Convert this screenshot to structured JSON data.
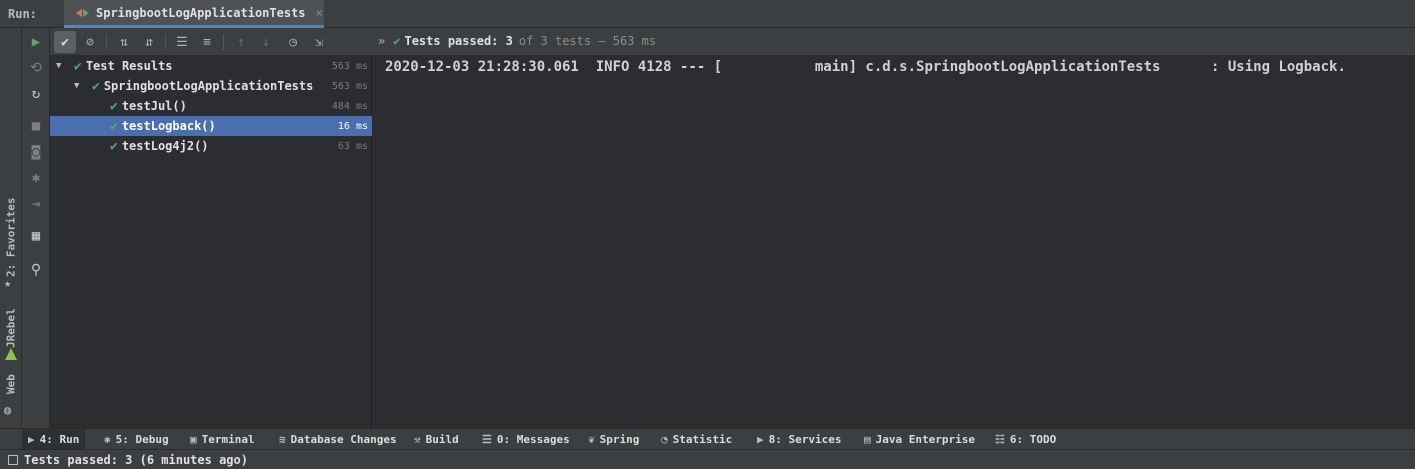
{
  "runbar": {
    "label": "Run:",
    "tab_title": "SpringbootLogApplicationTests",
    "close_glyph": "×"
  },
  "left_stripe": {
    "favorites": "2: Favorites",
    "jrebel": "JRebel",
    "web": "Web"
  },
  "tests_toolbar": {
    "chevron": "»",
    "status_passed": "Tests passed: 3",
    "status_rest": "of 3 tests – 563 ms"
  },
  "tree": {
    "rows": [
      {
        "name": "Test Results",
        "duration": "563 ms"
      },
      {
        "name": "SpringbootLogApplicationTests",
        "duration": "563 ms"
      },
      {
        "name": "testJul()",
        "duration": "484 ms"
      },
      {
        "name": "testLogback()",
        "duration": "16 ms"
      },
      {
        "name": "testLog4j2()",
        "duration": "63 ms"
      }
    ]
  },
  "console": {
    "line": "2020-12-03 21:28:30.061  INFO 4128 --- [           main] c.d.s.SpringbootLogApplicationTests      : Using Logback."
  },
  "tool_windows": [
    {
      "label": "4: Run",
      "icon": "play-icon"
    },
    {
      "label": "5: Debug",
      "icon": "bug-icon"
    },
    {
      "label": "Terminal",
      "icon": "terminal-icon"
    },
    {
      "label": "Database Changes",
      "icon": "database-icon"
    },
    {
      "label": "Build",
      "icon": "hammer-icon"
    },
    {
      "label": "0: Messages",
      "icon": "messages-icon"
    },
    {
      "label": "Spring",
      "icon": "spring-icon"
    },
    {
      "label": "Statistic",
      "icon": "statistic-icon"
    },
    {
      "label": "8: Services",
      "icon": "services-icon"
    },
    {
      "label": "Java Enterprise",
      "icon": "java-enterprise-icon"
    },
    {
      "label": "6: TODO",
      "icon": "todo-icon"
    }
  ],
  "statusbar": {
    "text": "Tests passed: 3 (6 minutes ago)"
  },
  "colors": {
    "accent": "#4a88c7",
    "selection": "#4b6eaf",
    "success": "#59a869",
    "background": "#2b2d30",
    "panel": "#3c3f41"
  }
}
